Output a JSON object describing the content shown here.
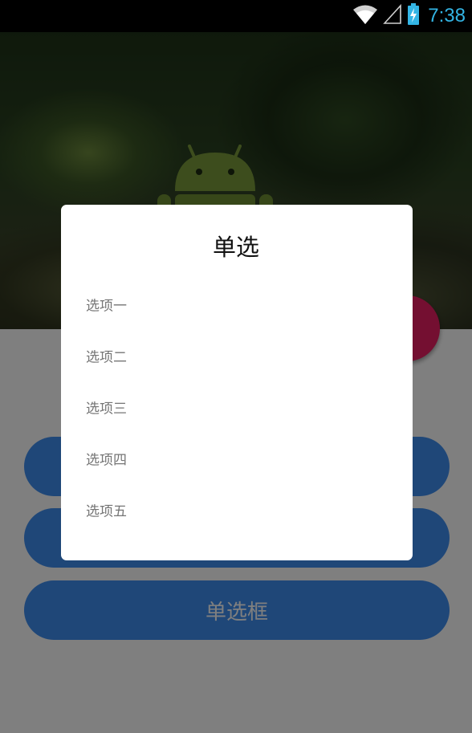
{
  "status_bar": {
    "time": "7:38",
    "icons": [
      "wifi-icon",
      "cellular-signal-icon",
      "battery-charging-icon"
    ],
    "time_color": "#33b5e5"
  },
  "header": {
    "image": "android-robot-forest-photo"
  },
  "fab": {
    "icon": "star-icon",
    "color": "#e91e63"
  },
  "buttons": [
    {
      "label": ""
    },
    {
      "label": ""
    },
    {
      "label": "单选框"
    }
  ],
  "button_color": "#3f8ef0",
  "dialog": {
    "title": "单选",
    "options": [
      "选项一",
      "选项二",
      "选项三",
      "选项四",
      "选项五"
    ]
  }
}
